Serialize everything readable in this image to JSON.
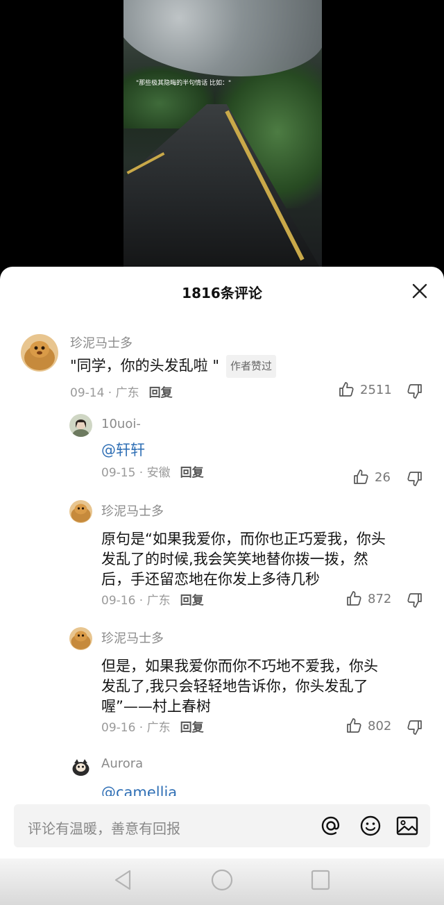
{
  "video": {
    "caption": "\"那些极其隐晦的半句情话 比如：\""
  },
  "sheet": {
    "title": "1816条评论"
  },
  "comments": [
    {
      "user": "珍泥马士多",
      "text": "\"同学，你的头发乱啦 \"",
      "badge": "作者赞过",
      "date": "09-14 · 广东",
      "reply_label": "回复",
      "likes": "2511"
    },
    {
      "user": "10uoi-",
      "text": "@轩轩",
      "date": "09-15 · 安徽",
      "reply_label": "回复",
      "likes": "26"
    },
    {
      "user": "珍泥马士多",
      "text_lines": [
        "原句是“如果我爱你，而你也正巧爱我，你头",
        "发乱了的时候,我会笑笑地替你拨一拨，然",
        "后，手还留恋地在你发上多待几秒"
      ],
      "date": "09-16 · 广东",
      "reply_label": "回复",
      "likes": "872"
    },
    {
      "user": "珍泥马士多",
      "text_lines": [
        "但是，如果我爱你而你不巧地不爱我，你头",
        "发乱了,我只会轻轻地告诉你，你头发乱了",
        "喔”——村上春树"
      ],
      "date": "09-16 · 广东",
      "reply_label": "回复",
      "likes": "802"
    },
    {
      "user": "Aurora",
      "text": "@camellia"
    }
  ],
  "input": {
    "placeholder": "评论有温暖，善意有回报"
  },
  "colors": {
    "mention": "#2f6fb5",
    "sheet_bg": "#ffffff",
    "input_bg": "#f3f3f3"
  }
}
